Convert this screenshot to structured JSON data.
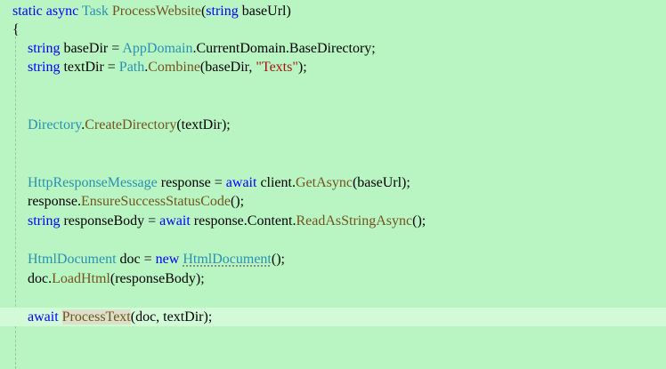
{
  "editor": {
    "signature": {
      "kw_static_async": "static async",
      "type_task": "Task",
      "method_name": "ProcessWebsite",
      "param_open": "(",
      "kw_string": "string",
      "param_rest": " baseUrl)"
    },
    "open_brace": "{",
    "line_basedir": {
      "kw_string": "string",
      "var_part": " baseDir = ",
      "type_appdomain": "AppDomain",
      "rest": ".CurrentDomain.BaseDirectory;"
    },
    "line_textdir": {
      "kw_string": "string",
      "var_part": " textDir = ",
      "type_path": "Path",
      "dot": ".",
      "method_combine": "Combine",
      "args_open": "(baseDir, ",
      "string_literal": "\"Texts\"",
      "args_close": ");"
    },
    "line_createdir": {
      "type_directory": "Directory",
      "dot": ".",
      "method_createdirectory": "CreateDirectory",
      "args": "(textDir);"
    },
    "line_response": {
      "type_httpresponse": "HttpResponseMessage",
      "mid": " response = ",
      "kw_await": "await",
      "client_part": " client.",
      "method_getasync": "GetAsync",
      "args": "(baseUrl);"
    },
    "line_ensure": {
      "obj": "response.",
      "method_ensure": "EnsureSuccessStatusCode",
      "args": "();"
    },
    "line_body": {
      "kw_string": "string",
      "mid": " responseBody = ",
      "kw_await": "await",
      "content_part": " response.Content.",
      "method_readasstring": "ReadAsStringAsync",
      "args": "();"
    },
    "line_doc": {
      "type_htmldoc": "HtmlDocument",
      "mid": " doc = ",
      "kw_new": "new",
      "space": " ",
      "type_htmldoc_ctor": "HtmlDocument",
      "args": "();"
    },
    "line_loadhtml": {
      "obj": "doc.",
      "method_loadhtml": "LoadHtml",
      "args": "(responseBody);"
    },
    "line_processtext": {
      "kw_await": "await",
      "space": " ",
      "method_processtext": "ProcessText",
      "args": "(doc, textDir);"
    }
  },
  "colors": {
    "background": "#b9f5c3",
    "current_line": "#d2fad7",
    "keyword": "#0000ff",
    "type": "#2b91af",
    "method": "#74531f",
    "string": "#a31515",
    "identifier": "#000000"
  }
}
